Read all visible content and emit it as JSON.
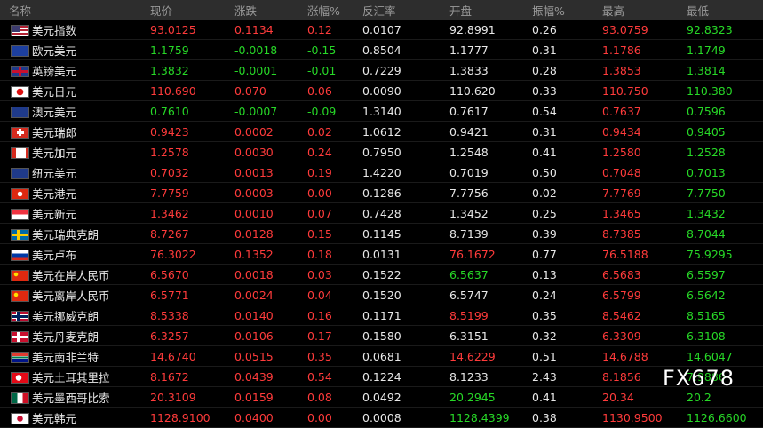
{
  "columns": [
    "名称",
    "现价",
    "涨跌",
    "涨幅%",
    "反汇率",
    "开盘",
    "振幅%",
    "最高",
    "最低"
  ],
  "colors": {
    "up": "#ff3b3b",
    "down": "#27d827",
    "neutral": "#e8e8e8"
  },
  "watermark": "FX678",
  "rows": [
    {
      "flag": "us",
      "name": "美元指数",
      "price": "93.0125",
      "change": "0.1134",
      "pct": "0.12",
      "inverse": "0.0107",
      "open": "92.8991",
      "amp": "0.26",
      "high": "93.0759",
      "low": "92.8323",
      "pc": "up",
      "cc": "up",
      "oc": "nt",
      "hc": "up",
      "lc": "dn"
    },
    {
      "flag": "eu",
      "name": "欧元美元",
      "price": "1.1759",
      "change": "-0.0018",
      "pct": "-0.15",
      "inverse": "0.8504",
      "open": "1.1777",
      "amp": "0.31",
      "high": "1.1786",
      "low": "1.1749",
      "pc": "dn",
      "cc": "dn",
      "oc": "nt",
      "hc": "up",
      "lc": "dn"
    },
    {
      "flag": "gb",
      "name": "英镑美元",
      "price": "1.3832",
      "change": "-0.0001",
      "pct": "-0.01",
      "inverse": "0.7229",
      "open": "1.3833",
      "amp": "0.28",
      "high": "1.3853",
      "low": "1.3814",
      "pc": "dn",
      "cc": "dn",
      "oc": "nt",
      "hc": "up",
      "lc": "dn"
    },
    {
      "flag": "jp",
      "name": "美元日元",
      "price": "110.690",
      "change": "0.070",
      "pct": "0.06",
      "inverse": "0.0090",
      "open": "110.620",
      "amp": "0.33",
      "high": "110.750",
      "low": "110.380",
      "pc": "up",
      "cc": "up",
      "oc": "nt",
      "hc": "up",
      "lc": "dn"
    },
    {
      "flag": "au",
      "name": "澳元美元",
      "price": "0.7610",
      "change": "-0.0007",
      "pct": "-0.09",
      "inverse": "1.3140",
      "open": "0.7617",
      "amp": "0.54",
      "high": "0.7637",
      "low": "0.7596",
      "pc": "dn",
      "cc": "dn",
      "oc": "nt",
      "hc": "up",
      "lc": "dn"
    },
    {
      "flag": "ch",
      "name": "美元瑞郎",
      "price": "0.9423",
      "change": "0.0002",
      "pct": "0.02",
      "inverse": "1.0612",
      "open": "0.9421",
      "amp": "0.31",
      "high": "0.9434",
      "low": "0.9405",
      "pc": "up",
      "cc": "up",
      "oc": "nt",
      "hc": "up",
      "lc": "dn"
    },
    {
      "flag": "ca",
      "name": "美元加元",
      "price": "1.2578",
      "change": "0.0030",
      "pct": "0.24",
      "inverse": "0.7950",
      "open": "1.2548",
      "amp": "0.41",
      "high": "1.2580",
      "low": "1.2528",
      "pc": "up",
      "cc": "up",
      "oc": "nt",
      "hc": "up",
      "lc": "dn"
    },
    {
      "flag": "nz",
      "name": "纽元美元",
      "price": "0.7032",
      "change": "0.0013",
      "pct": "0.19",
      "inverse": "1.4220",
      "open": "0.7019",
      "amp": "0.50",
      "high": "0.7048",
      "low": "0.7013",
      "pc": "up",
      "cc": "up",
      "oc": "nt",
      "hc": "up",
      "lc": "dn"
    },
    {
      "flag": "hk",
      "name": "美元港元",
      "price": "7.7759",
      "change": "0.0003",
      "pct": "0.00",
      "inverse": "0.1286",
      "open": "7.7756",
      "amp": "0.02",
      "high": "7.7769",
      "low": "7.7750",
      "pc": "up",
      "cc": "up",
      "oc": "nt",
      "hc": "up",
      "lc": "dn"
    },
    {
      "flag": "sg",
      "name": "美元新元",
      "price": "1.3462",
      "change": "0.0010",
      "pct": "0.07",
      "inverse": "0.7428",
      "open": "1.3452",
      "amp": "0.25",
      "high": "1.3465",
      "low": "1.3432",
      "pc": "up",
      "cc": "up",
      "oc": "nt",
      "hc": "up",
      "lc": "dn"
    },
    {
      "flag": "se",
      "name": "美元瑞典克朗",
      "price": "8.7267",
      "change": "0.0128",
      "pct": "0.15",
      "inverse": "0.1145",
      "open": "8.7139",
      "amp": "0.39",
      "high": "8.7385",
      "low": "8.7044",
      "pc": "up",
      "cc": "up",
      "oc": "nt",
      "hc": "up",
      "lc": "dn"
    },
    {
      "flag": "ru",
      "name": "美元卢布",
      "price": "76.3022",
      "change": "0.1352",
      "pct": "0.18",
      "inverse": "0.0131",
      "open": "76.1672",
      "amp": "0.77",
      "high": "76.5188",
      "low": "75.9295",
      "pc": "up",
      "cc": "up",
      "oc": "up",
      "hc": "up",
      "lc": "dn"
    },
    {
      "flag": "cn",
      "name": "美元在岸人民币",
      "price": "6.5670",
      "change": "0.0018",
      "pct": "0.03",
      "inverse": "0.1522",
      "open": "6.5637",
      "amp": "0.13",
      "high": "6.5683",
      "low": "6.5597",
      "pc": "up",
      "cc": "up",
      "oc": "dn",
      "hc": "up",
      "lc": "dn"
    },
    {
      "flag": "cn",
      "name": "美元离岸人民币",
      "price": "6.5771",
      "change": "0.0024",
      "pct": "0.04",
      "inverse": "0.1520",
      "open": "6.5747",
      "amp": "0.24",
      "high": "6.5799",
      "low": "6.5642",
      "pc": "up",
      "cc": "up",
      "oc": "nt",
      "hc": "up",
      "lc": "dn"
    },
    {
      "flag": "no",
      "name": "美元挪威克朗",
      "price": "8.5338",
      "change": "0.0140",
      "pct": "0.16",
      "inverse": "0.1171",
      "open": "8.5199",
      "amp": "0.35",
      "high": "8.5462",
      "low": "8.5165",
      "pc": "up",
      "cc": "up",
      "oc": "up",
      "hc": "up",
      "lc": "dn"
    },
    {
      "flag": "dk",
      "name": "美元丹麦克朗",
      "price": "6.3257",
      "change": "0.0106",
      "pct": "0.17",
      "inverse": "0.1580",
      "open": "6.3151",
      "amp": "0.32",
      "high": "6.3309",
      "low": "6.3108",
      "pc": "up",
      "cc": "up",
      "oc": "nt",
      "hc": "up",
      "lc": "dn"
    },
    {
      "flag": "za",
      "name": "美元南非兰特",
      "price": "14.6740",
      "change": "0.0515",
      "pct": "0.35",
      "inverse": "0.0681",
      "open": "14.6229",
      "amp": "0.51",
      "high": "14.6788",
      "low": "14.6047",
      "pc": "up",
      "cc": "up",
      "oc": "up",
      "hc": "up",
      "lc": "dn"
    },
    {
      "flag": "tr",
      "name": "美元土耳其里拉",
      "price": "8.1672",
      "change": "0.0439",
      "pct": "0.54",
      "inverse": "0.1224",
      "open": "8.1233",
      "amp": "2.43",
      "high": "8.1856",
      "low": "7.9886",
      "pc": "up",
      "cc": "up",
      "oc": "nt",
      "hc": "up",
      "lc": "dn"
    },
    {
      "flag": "mx",
      "name": "美元墨西哥比索",
      "price": "20.3109",
      "change": "0.0159",
      "pct": "0.08",
      "inverse": "0.0492",
      "open": "20.2945",
      "amp": "0.41",
      "high": "20.34",
      "low": "20.2",
      "pc": "up",
      "cc": "up",
      "oc": "dn",
      "hc": "up",
      "lc": "dn"
    },
    {
      "flag": "kr",
      "name": "美元韩元",
      "price": "1128.9100",
      "change": "0.0400",
      "pct": "0.00",
      "inverse": "0.0008",
      "open": "1128.4399",
      "amp": "0.38",
      "high": "1130.9500",
      "low": "1126.6600",
      "pc": "up",
      "cc": "up",
      "oc": "dn",
      "hc": "up",
      "lc": "dn"
    }
  ]
}
